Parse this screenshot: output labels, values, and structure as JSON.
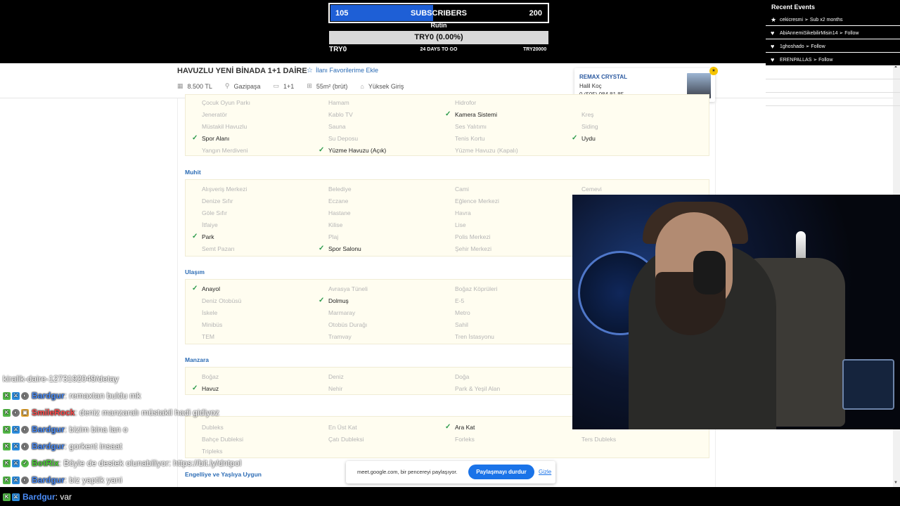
{
  "goal": {
    "start": "105",
    "label": "SUBSCRIBERS",
    "end": "200",
    "progress": 0.47
  },
  "rutin": "Rutin",
  "try_goal": {
    "text": "TRY0 (0.00%)",
    "start": "TRY0",
    "days": "24 DAYS TO GO",
    "end": "TRY20000"
  },
  "events": {
    "title": "Recent Events",
    "items": [
      {
        "icon": "★",
        "text": "cekicresmi ➢ Sub x2 months"
      },
      {
        "icon": "♥",
        "text": "AbiAnnemiSikebilirMisin14 ➢ Follow"
      },
      {
        "icon": "♥",
        "text": "1ghoshado ➢ Follow"
      },
      {
        "icon": "♥",
        "text": "ERENPALLAS ➢ Follow"
      }
    ]
  },
  "listing": {
    "title": "HAVUZLU YENİ BİNADA 1+1 DAİRE",
    "fav": "İlanı Favorilerime Ekle",
    "price": "8.500 TL",
    "location": "Gazipaşa",
    "rooms": "1+1",
    "area": "55m² (brüt)",
    "floor": "Yüksek Giriş"
  },
  "agent": {
    "company": "REMAX CRYSTAL",
    "name": "Halil Koç",
    "phone": "0 (505) 084 81 85"
  },
  "sections": {
    "top": [
      [
        "Çocuk Oyun Parkı",
        false
      ],
      [
        "Hamam",
        false
      ],
      [
        "Hidrofor",
        false
      ],
      [
        "Jeneratör",
        false
      ],
      [
        "Kablo TV",
        false
      ],
      [
        "Kamera Sistemi",
        true
      ],
      [
        "Kreş",
        false
      ],
      [
        "Müstakil Havuzlu",
        false
      ],
      [
        "Sauna",
        false
      ],
      [
        "Ses Yalıtımı",
        false
      ],
      [
        "Siding",
        false
      ],
      [
        "Spor Alanı",
        true
      ],
      [
        "Su Deposu",
        false
      ],
      [
        "Tenis Kortu",
        false
      ],
      [
        "Uydu",
        true
      ],
      [
        "Yangın Merdiveni",
        false
      ],
      [
        "Yüzme Havuzu (Açık)",
        true
      ],
      [
        "Yüzme Havuzu (Kapalı)",
        false
      ]
    ],
    "muhit_title": "Muhit",
    "muhit": [
      [
        "Alışveriş Merkezi",
        false
      ],
      [
        "Belediye",
        false
      ],
      [
        "Cami",
        false
      ],
      [
        "Cemevi",
        false
      ],
      [
        "Denize Sıfır",
        false
      ],
      [
        "Eczane",
        false
      ],
      [
        "Eğlence Merkezi",
        false
      ],
      [
        "Göle Sıfır",
        false
      ],
      [
        "Hastane",
        false
      ],
      [
        "Havra",
        false
      ],
      [
        "İtfaiye",
        false
      ],
      [
        "Kilise",
        false
      ],
      [
        "Lise",
        false
      ],
      [
        "Park",
        true
      ],
      [
        "Plaj",
        false
      ],
      [
        "Polis Merkezi",
        false
      ],
      [
        "Semt Pazarı",
        false
      ],
      [
        "Spor Salonu",
        true
      ],
      [
        "Şehir Merkezi",
        false
      ]
    ],
    "ulasim_title": "Ulaşım",
    "ulasim": [
      [
        "Anayol",
        true
      ],
      [
        "Avrasya Tüneli",
        false
      ],
      [
        "Boğaz Köprüleri",
        false
      ],
      [
        "Deniz Otobüsü",
        false
      ],
      [
        "Dolmuş",
        true
      ],
      [
        "E-5",
        false
      ],
      [
        "İskele",
        false
      ],
      [
        "Marmaray",
        false
      ],
      [
        "Metro",
        false
      ],
      [
        "Minibüs",
        false
      ],
      [
        "Otobüs Durağı",
        false
      ],
      [
        "Sahil",
        false
      ],
      [
        "TEM",
        false
      ],
      [
        "Tramvay",
        false
      ],
      [
        "Tren İstasyonu",
        false
      ]
    ],
    "manzara_title": "Manzara",
    "manzara": [
      [
        "Boğaz",
        false
      ],
      [
        "Deniz",
        false
      ],
      [
        "Doğa",
        false
      ],
      [
        "Havuz",
        true
      ],
      [
        "Nehir",
        false
      ],
      [
        "Park & Yeşil Alan",
        false
      ]
    ],
    "tip": [
      [
        "Dubleks",
        false
      ],
      [
        "En Üst Kat",
        false
      ],
      [
        "Ara Kat",
        true
      ],
      [
        "Bahçe Dubleksi",
        false
      ],
      [
        "Çatı Dubleksi",
        false
      ],
      [
        "Forleks",
        false
      ],
      [
        "Ters Dubleks",
        false
      ],
      [
        "Tripleks",
        false
      ]
    ],
    "engelli_title": "Engelliye ve Yaşlıya Uygun"
  },
  "share": {
    "text": "meet.google.com, bir pencereyi paylaşıyor.",
    "button": "Paylaşmayı durdur",
    "hide": "Gizle"
  },
  "chat": [
    {
      "text": "kiralik-daire-1273192049/detay",
      "user": "",
      "color": "#ffffff"
    },
    {
      "user": "Bardgur",
      "msg": ": remaxtan buldu mk",
      "color": "#4a8bf5"
    },
    {
      "user": "SmileRock",
      "msg": ": deniz manzaralı müstakil hadi gidiyoz",
      "color": "#ff4b4b"
    },
    {
      "user": "Bardgur",
      "msg": ": bizim bina lan o",
      "color": "#4a8bf5"
    },
    {
      "user": "Bardgur",
      "msg": ": gorkent insaat",
      "color": "#4a8bf5"
    },
    {
      "user": "BotRix",
      "msg": ": Böyle de destek olunabiliyor: https://bit.ly/dntpol",
      "color": "#4cd137"
    },
    {
      "user": "Bardgur",
      "msg": ": biz yaptik yani",
      "color": "#4a8bf5"
    },
    {
      "user": "Bardgur",
      "msg": ": var",
      "color": "#4a8bf5"
    }
  ]
}
